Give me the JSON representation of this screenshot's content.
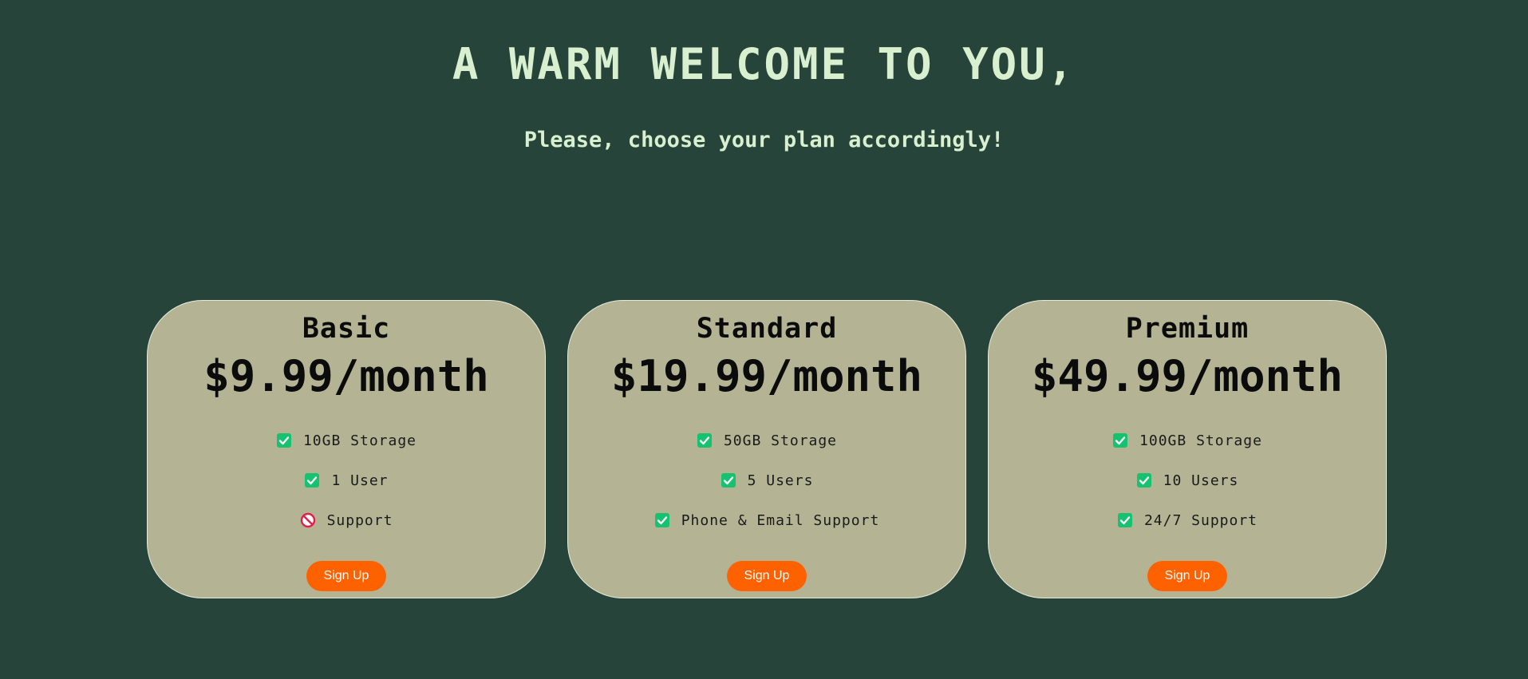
{
  "header": {
    "title": "A WARM WELCOME TO YOU,",
    "subtitle": "Please, choose your plan accordingly!"
  },
  "colors": {
    "background": "#264439",
    "heading_text": "#d8f0cf",
    "card_background": "#b4b495",
    "card_border": "#e9eadc",
    "check_green": "#14c26f",
    "block_red": "#e0204a",
    "button_orange": "#fe6200"
  },
  "plans": [
    {
      "name": "Basic",
      "price": "$9.99/month",
      "features": [
        {
          "text": "10GB Storage",
          "icon": "check-icon"
        },
        {
          "text": "1 User",
          "icon": "check-icon"
        },
        {
          "text": "Support",
          "icon": "prohibited-icon"
        }
      ],
      "button_label": "Sign Up"
    },
    {
      "name": "Standard",
      "price": "$19.99/month",
      "features": [
        {
          "text": "50GB Storage",
          "icon": "check-icon"
        },
        {
          "text": "5 Users",
          "icon": "check-icon"
        },
        {
          "text": "Phone & Email Support",
          "icon": "check-icon"
        }
      ],
      "button_label": "Sign Up"
    },
    {
      "name": "Premium",
      "price": "$49.99/month",
      "features": [
        {
          "text": "100GB Storage",
          "icon": "check-icon"
        },
        {
          "text": "10 Users",
          "icon": "check-icon"
        },
        {
          "text": "24/7 Support",
          "icon": "check-icon"
        }
      ],
      "button_label": "Sign Up"
    }
  ]
}
